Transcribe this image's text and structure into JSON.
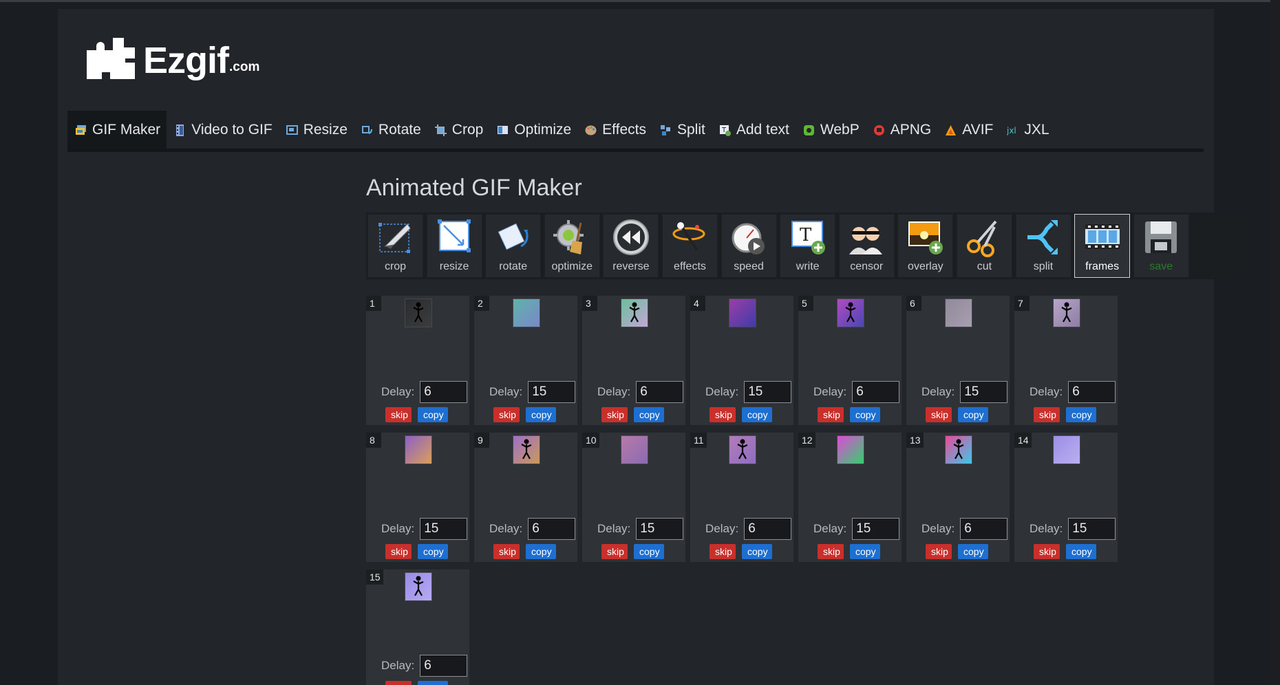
{
  "site": {
    "logo_text": "Ezgif",
    "logo_tld": ".com"
  },
  "nav": [
    {
      "label": "GIF Maker",
      "icon": "gif-maker-icon",
      "active": true
    },
    {
      "label": "Video to GIF",
      "icon": "film-icon"
    },
    {
      "label": "Resize",
      "icon": "resize-icon"
    },
    {
      "label": "Rotate",
      "icon": "rotate-icon"
    },
    {
      "label": "Crop",
      "icon": "crop-icon"
    },
    {
      "label": "Optimize",
      "icon": "optimize-icon"
    },
    {
      "label": "Effects",
      "icon": "palette-icon"
    },
    {
      "label": "Split",
      "icon": "split-icon"
    },
    {
      "label": "Add text",
      "icon": "add-text-icon"
    },
    {
      "label": "WebP",
      "icon": "webp-icon"
    },
    {
      "label": "APNG",
      "icon": "apng-icon"
    },
    {
      "label": "AVIF",
      "icon": "avif-icon"
    },
    {
      "label": "JXL",
      "icon": "jxl-icon"
    }
  ],
  "page": {
    "title": "Animated GIF Maker"
  },
  "tools": [
    {
      "label": "crop",
      "icon": "crop-tool-icon"
    },
    {
      "label": "resize",
      "icon": "resize-tool-icon"
    },
    {
      "label": "rotate",
      "icon": "rotate-tool-icon"
    },
    {
      "label": "optimize",
      "icon": "optimize-tool-icon"
    },
    {
      "label": "reverse",
      "icon": "reverse-tool-icon"
    },
    {
      "label": "effects",
      "icon": "effects-tool-icon"
    },
    {
      "label": "speed",
      "icon": "speed-tool-icon"
    },
    {
      "label": "write",
      "icon": "write-tool-icon"
    },
    {
      "label": "censor",
      "icon": "censor-tool-icon"
    },
    {
      "label": "overlay",
      "icon": "overlay-tool-icon"
    },
    {
      "label": "cut",
      "icon": "scissors-tool-icon"
    },
    {
      "label": "split",
      "icon": "split-tool-icon"
    },
    {
      "label": "frames",
      "icon": "frames-tool-icon",
      "active": true
    },
    {
      "label": "save",
      "icon": "save-tool-icon"
    }
  ],
  "frame_labels": {
    "delay": "Delay:",
    "skip": "skip",
    "copy": "copy"
  },
  "frames": [
    {
      "num": "1",
      "delay": "6",
      "thumb": "dark"
    },
    {
      "num": "2",
      "delay": "15",
      "thumb": "teal"
    },
    {
      "num": "3",
      "delay": "6",
      "thumb": "teal-figure"
    },
    {
      "num": "4",
      "delay": "15",
      "thumb": "purple"
    },
    {
      "num": "5",
      "delay": "6",
      "thumb": "purple-figure"
    },
    {
      "num": "6",
      "delay": "15",
      "thumb": "grey"
    },
    {
      "num": "7",
      "delay": "6",
      "thumb": "light-figure"
    },
    {
      "num": "8",
      "delay": "15",
      "thumb": "violet"
    },
    {
      "num": "9",
      "delay": "6",
      "thumb": "violet-figure"
    },
    {
      "num": "10",
      "delay": "15",
      "thumb": "pink"
    },
    {
      "num": "11",
      "delay": "6",
      "thumb": "pink-figure"
    },
    {
      "num": "12",
      "delay": "15",
      "thumb": "rainbow"
    },
    {
      "num": "13",
      "delay": "6",
      "thumb": "rainbow-figure"
    },
    {
      "num": "14",
      "delay": "15",
      "thumb": "lavender"
    },
    {
      "num": "15",
      "delay": "6",
      "thumb": "lavender-figure"
    }
  ],
  "colors": {
    "accent_skip": "#c9302c",
    "accent_copy": "#1d6fd1",
    "save_text": "#2a7b2a"
  }
}
